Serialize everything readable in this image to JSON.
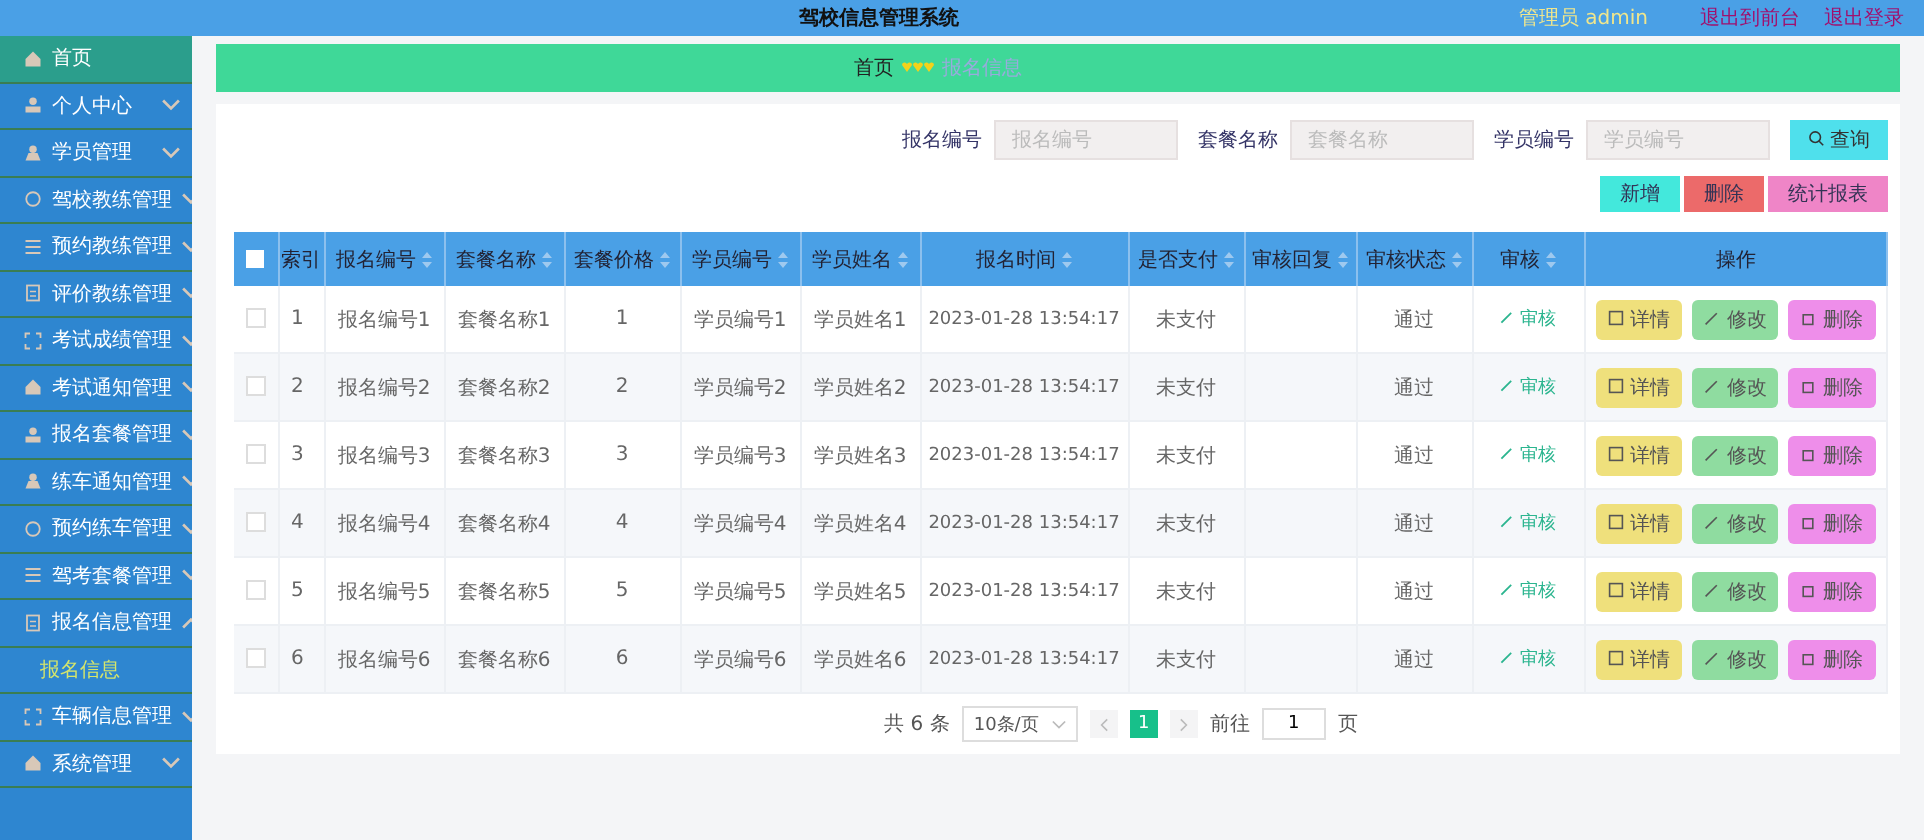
{
  "header": {
    "title": "驾校信息管理系统",
    "user": "管理员 admin",
    "links": [
      "退出到前台",
      "退出登录"
    ]
  },
  "sidebar": {
    "items": [
      {
        "label": "首页",
        "selected": true
      },
      {
        "label": "个人中心",
        "selected": false,
        "expanded": false
      },
      {
        "label": "学员管理",
        "selected": false,
        "expanded": false
      },
      {
        "label": "驾校教练管理",
        "selected": false,
        "expanded": false
      },
      {
        "label": "预约教练管理",
        "selected": false,
        "expanded": false
      },
      {
        "label": "评价教练管理",
        "selected": false,
        "expanded": false
      },
      {
        "label": "考试成绩管理",
        "selected": false,
        "expanded": false
      },
      {
        "label": "考试通知管理",
        "selected": false,
        "expanded": false
      },
      {
        "label": "报名套餐管理",
        "selected": false,
        "expanded": false
      },
      {
        "label": "练车通知管理",
        "selected": false,
        "expanded": false
      },
      {
        "label": "预约练车管理",
        "selected": false,
        "expanded": false
      },
      {
        "label": "驾考套餐管理",
        "selected": false,
        "expanded": false
      },
      {
        "label": "报名信息管理",
        "selected": false,
        "expanded": true,
        "children": [
          {
            "label": "报名信息",
            "selected": true
          }
        ]
      },
      {
        "label": "车辆信息管理",
        "selected": false,
        "expanded": false
      },
      {
        "label": "系统管理",
        "selected": false,
        "expanded": false
      }
    ]
  },
  "breadcrumb": [
    "首页",
    "报名信息"
  ],
  "search": {
    "fields": [
      {
        "label": "报名编号",
        "placeholder": "报名编号"
      },
      {
        "label": "套餐名称",
        "placeholder": "套餐名称"
      },
      {
        "label": "学员编号",
        "placeholder": "学员编号"
      }
    ],
    "button": "查询"
  },
  "actions": [
    {
      "label": "新增",
      "kind": "add"
    },
    {
      "label": "删除",
      "kind": "delete"
    },
    {
      "label": "统计报表",
      "kind": "chart"
    }
  ],
  "table": {
    "all_checked": false,
    "columns": [
      {
        "label": "索引"
      },
      {
        "label": "报名编号",
        "sortable": true
      },
      {
        "label": "套餐名称",
        "sortable": true
      },
      {
        "label": "套餐价格",
        "sortable": true
      },
      {
        "label": "学员编号",
        "sortable": true
      },
      {
        "label": "学员姓名",
        "sortable": true
      },
      {
        "label": "报名时间",
        "sortable": true
      },
      {
        "label": "是否支付",
        "sortable": true
      },
      {
        "label": "审核回复",
        "sortable": true
      },
      {
        "label": "审核状态",
        "sortable": true
      },
      {
        "label": "审核",
        "sortable": true
      },
      {
        "label": "操作"
      }
    ],
    "rows": [
      {
        "checked": false,
        "cells": [
          "1",
          "报名编号1",
          "套餐名称1",
          "1",
          "学员编号1",
          "学员姓名1",
          "2023-01-28 13:54:17",
          "未支付",
          "",
          "通过"
        ],
        "review": "审核",
        "buttons": [
          "详情",
          "修改",
          "删除"
        ]
      },
      {
        "checked": false,
        "cells": [
          "2",
          "报名编号2",
          "套餐名称2",
          "2",
          "学员编号2",
          "学员姓名2",
          "2023-01-28 13:54:17",
          "未支付",
          "",
          "通过"
        ],
        "review": "审核",
        "buttons": [
          "详情",
          "修改",
          "删除"
        ]
      },
      {
        "checked": false,
        "cells": [
          "3",
          "报名编号3",
          "套餐名称3",
          "3",
          "学员编号3",
          "学员姓名3",
          "2023-01-28 13:54:17",
          "未支付",
          "",
          "通过"
        ],
        "review": "审核",
        "buttons": [
          "详情",
          "修改",
          "删除"
        ]
      },
      {
        "checked": false,
        "cells": [
          "4",
          "报名编号4",
          "套餐名称4",
          "4",
          "学员编号4",
          "学员姓名4",
          "2023-01-28 13:54:17",
          "未支付",
          "",
          "通过"
        ],
        "review": "审核",
        "buttons": [
          "详情",
          "修改",
          "删除"
        ]
      },
      {
        "checked": false,
        "cells": [
          "5",
          "报名编号5",
          "套餐名称5",
          "5",
          "学员编号5",
          "学员姓名5",
          "2023-01-28 13:54:17",
          "未支付",
          "",
          "通过"
        ],
        "review": "审核",
        "buttons": [
          "详情",
          "修改",
          "删除"
        ]
      },
      {
        "checked": false,
        "cells": [
          "6",
          "报名编号6",
          "套餐名称6",
          "6",
          "学员编号6",
          "学员姓名6",
          "2023-01-28 13:54:17",
          "未支付",
          "",
          "通过"
        ],
        "review": "审核",
        "buttons": [
          "详情",
          "修改",
          "删除"
        ]
      }
    ]
  },
  "pagination": {
    "total": "共 6 条",
    "page_size": "10条/页",
    "pages": [
      {
        "label": "1",
        "selected": true
      }
    ],
    "goto_label": "前往",
    "goto_value": "1",
    "goto_suffix": "页"
  }
}
